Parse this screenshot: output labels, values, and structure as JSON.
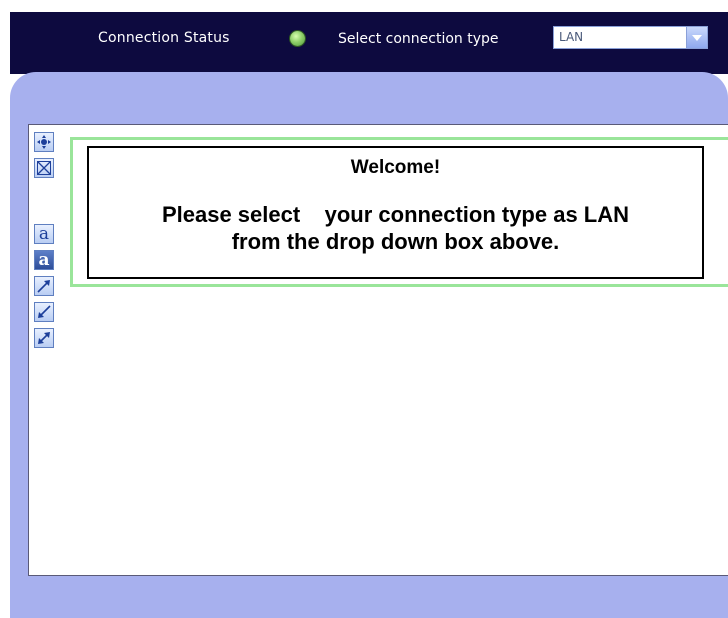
{
  "header": {
    "connection_status_label": "Connection Status",
    "select_label": "Select connection type",
    "select_value": "LAN",
    "status_color": "#8fd06a"
  },
  "toolbar": {
    "tools": [
      "move-icon",
      "shape-x-icon",
      "color-palette-icon",
      "text-icon",
      "text-bold-icon",
      "arrow-up-right-icon",
      "arrow-down-left-icon",
      "arrow-both-icon"
    ]
  },
  "welcome": {
    "title": "Welcome!",
    "message_line1": "Please select    your connection type as LAN",
    "message_line2": "from the drop down box above."
  },
  "colors": {
    "topbar": "#0d0a3f",
    "panel": "#a7b0ee",
    "highlight": "#9ae59a"
  }
}
